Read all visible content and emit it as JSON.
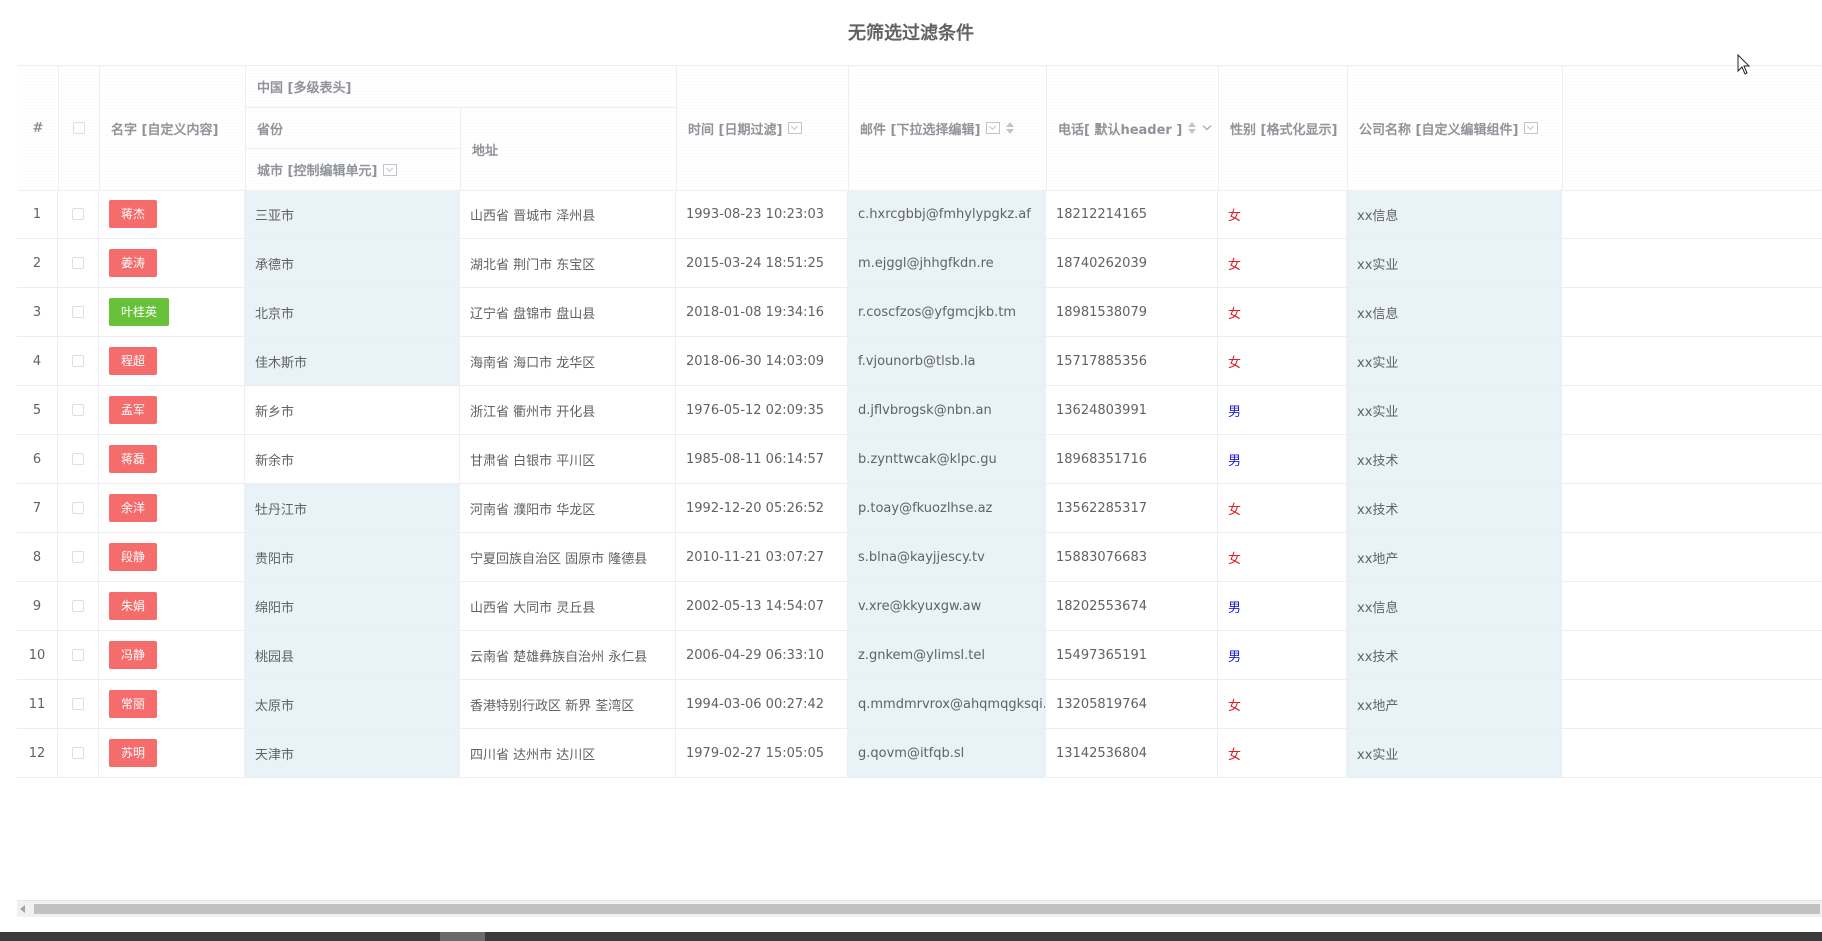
{
  "title": "无筛选过滤条件",
  "headers": {
    "index": "#",
    "name": "名字 [自定义内容]",
    "china": "中国 [多级表头]",
    "province": "省份",
    "city": "城市 [控制编辑单元]",
    "address": "地址",
    "time": "时间 [日期过滤]",
    "email": "邮件 [下拉选择编辑]",
    "phone": "电话[ 默认header ]",
    "sex": "性别 [格式化显示]",
    "company": "公司名称 [自定义编辑组件]"
  },
  "icons": {
    "filter": "filter-icon",
    "sort": "sort-icon",
    "chevron": "chevron-down-icon",
    "checkbox": "checkbox-icon",
    "scroll_left": "arrow-left-icon",
    "cursor": "mouse-pointer-icon"
  },
  "colors": {
    "tag_red": "#f56c6c",
    "tag_green": "#67c23a",
    "female": "#e02020",
    "male": "#1c1cd6",
    "highlight": "#e9f2f6"
  },
  "rows": [
    {
      "index": "1",
      "name": "蒋杰",
      "tag": "red",
      "city": "三亚市",
      "address": "山西省 晋城市 泽州县",
      "time": "1993-08-23 10:23:03",
      "email": "c.hxrcgbbj@fmhylypgkz.af",
      "phone": "18212214165",
      "sex": "女",
      "company": "xx信息"
    },
    {
      "index": "2",
      "name": "姜涛",
      "tag": "red",
      "city": "承德市",
      "address": "湖北省 荆门市 东宝区",
      "time": "2015-03-24 18:51:25",
      "email": "m.ejggl@jhhgfkdn.re",
      "phone": "18740262039",
      "sex": "女",
      "company": "xx实业"
    },
    {
      "index": "3",
      "name": "叶桂英",
      "tag": "green",
      "city": "北京市",
      "address": "辽宁省 盘锦市 盘山县",
      "time": "2018-01-08 19:34:16",
      "email": "r.coscfzos@yfgmcjkb.tm",
      "phone": "18981538079",
      "sex": "女",
      "company": "xx信息"
    },
    {
      "index": "4",
      "name": "程超",
      "tag": "red",
      "city": "佳木斯市",
      "address": "海南省 海口市 龙华区",
      "time": "2018-06-30 14:03:09",
      "email": "f.vjounorb@tlsb.la",
      "phone": "15717885356",
      "sex": "女",
      "company": "xx实业"
    },
    {
      "index": "5",
      "name": "孟军",
      "tag": "red",
      "city": "新乡市",
      "address": "浙江省 衢州市 开化县",
      "time": "1976-05-12 02:09:35",
      "email": "d.jflvbrogsk@nbn.an",
      "phone": "13624803991",
      "sex": "男",
      "company": "xx实业"
    },
    {
      "index": "6",
      "name": "蒋磊",
      "tag": "red",
      "city": "新余市",
      "address": "甘肃省 白银市 平川区",
      "time": "1985-08-11 06:14:57",
      "email": "b.zynttwcak@klpc.gu",
      "phone": "18968351716",
      "sex": "男",
      "company": "xx技术"
    },
    {
      "index": "7",
      "name": "余洋",
      "tag": "red",
      "city": "牡丹江市",
      "address": "河南省 濮阳市 华龙区",
      "time": "1992-12-20 05:26:52",
      "email": "p.toay@fkuozlhse.az",
      "phone": "13562285317",
      "sex": "女",
      "company": "xx技术"
    },
    {
      "index": "8",
      "name": "段静",
      "tag": "red",
      "city": "贵阳市",
      "address": "宁夏回族自治区 固原市 隆德县",
      "time": "2010-11-21 03:07:27",
      "email": "s.blna@kayjjescy.tv",
      "phone": "15883076683",
      "sex": "女",
      "company": "xx地产"
    },
    {
      "index": "9",
      "name": "朱娟",
      "tag": "red",
      "city": "绵阳市",
      "address": "山西省 大同市 灵丘县",
      "time": "2002-05-13 14:54:07",
      "email": "v.xre@kkyuxgw.aw",
      "phone": "18202553674",
      "sex": "男",
      "company": "xx信息"
    },
    {
      "index": "10",
      "name": "冯静",
      "tag": "red",
      "city": "桃园县",
      "address": "云南省 楚雄彝族自治州 永仁县",
      "time": "2006-04-29 06:33:10",
      "email": "z.gnkem@ylimsl.tel",
      "phone": "15497365191",
      "sex": "男",
      "company": "xx技术"
    },
    {
      "index": "11",
      "name": "常丽",
      "tag": "red",
      "city": "太原市",
      "address": "香港特别行政区 新界 荃湾区",
      "time": "1994-03-06 00:27:42",
      "email": "q.mmdmrvrox@ahqmqgksqi.cn",
      "phone": "13205819764",
      "sex": "女",
      "company": "xx地产"
    },
    {
      "index": "12",
      "name": "苏明",
      "tag": "red",
      "city": "天津市",
      "address": "四川省 达州市 达川区",
      "time": "1979-02-27 15:05:05",
      "email": "g.qovm@itfqb.sl",
      "phone": "13142536804",
      "sex": "女",
      "company": "xx实业"
    }
  ]
}
